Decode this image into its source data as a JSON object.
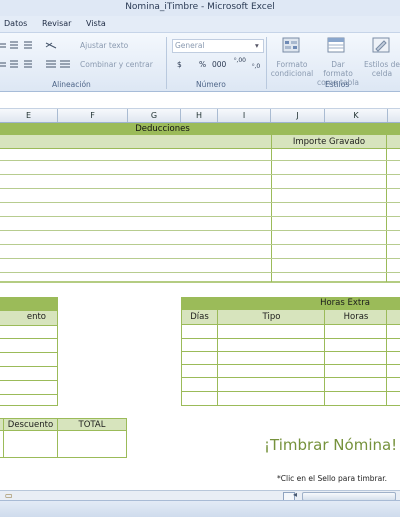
{
  "window": {
    "title": "Nomina_iTimbre  -  Microsoft Excel"
  },
  "menu": {
    "items": [
      "Datos",
      "Revisar",
      "Vista"
    ]
  },
  "ribbon": {
    "wrap_text": "Ajustar texto",
    "merge_center": "Combinar y centrar",
    "number_format": "General",
    "currency": "$",
    "percent": "%",
    "thousands": "000",
    "inc_decimal": "⁰,00",
    "dec_decimal": "⁰,0",
    "cond_format": [
      "Formato",
      "condicional"
    ],
    "format_table": [
      "Dar formato",
      "como tabla"
    ],
    "cell_styles": [
      "Estilos de",
      "celda"
    ],
    "groups": {
      "alignment": "Alineación",
      "number": "Número",
      "styles": "Estilos"
    }
  },
  "columns": [
    "E",
    "F",
    "G",
    "H",
    "I",
    "J",
    "K"
  ],
  "sheet": {
    "deducciones": "Deducciones",
    "importe_gravado": "Importe Gravado",
    "horas_extra": "Horas Extra",
    "dias": "Días",
    "tipo": "Tipo",
    "horas": "Horas",
    "cento": "ento",
    "descuento": "Descuento",
    "total": "TOTAL",
    "timbrar": "¡Timbrar Nómina!",
    "note": "*Clic en el Sello para timbrar."
  }
}
